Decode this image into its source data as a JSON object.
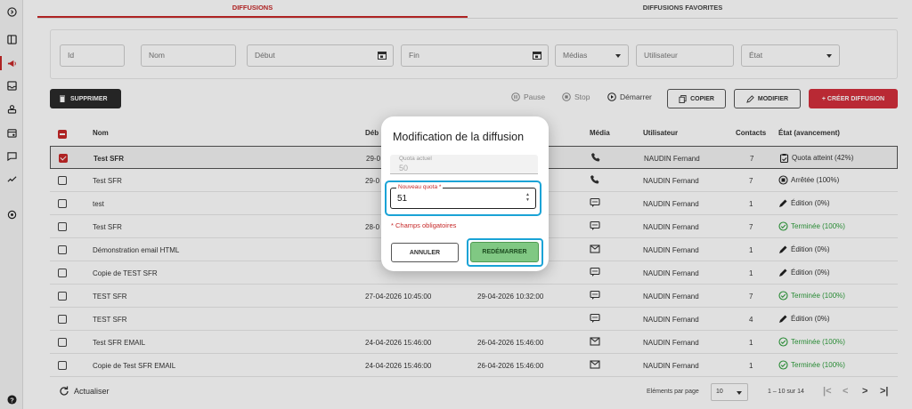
{
  "tabs": [
    {
      "label": "DIFFUSIONS",
      "active": true
    },
    {
      "label": "DIFFUSIONS FAVORITES",
      "active": false
    }
  ],
  "filters": {
    "id": "Id",
    "nom": "Nom",
    "debut": "Début",
    "fin": "Fin",
    "medias": "Médias",
    "utilisateur": "Utilisateur",
    "etat": "État"
  },
  "toolbar": {
    "delete": "SUPPRIMER",
    "pause": "Pause",
    "stop": "Stop",
    "start": "Démarrer",
    "copy": "COPIER",
    "edit": "MODIFIER",
    "create": "+ CRÉER DIFFUSION"
  },
  "table": {
    "headers": {
      "nom": "Nom",
      "debut": "Déb",
      "media": "Média",
      "utilisateur": "Utilisateur",
      "contacts": "Contacts",
      "etat": "État (avancement)"
    },
    "rows": [
      {
        "checked": true,
        "nom": "Test SFR",
        "debut": "29-0",
        "fin": "",
        "media": "phone",
        "user": "NAUDIN Fernand",
        "contacts": "7",
        "state": "Quota atteint (42%)",
        "state_kind": "quota",
        "bold": true
      },
      {
        "checked": false,
        "nom": "Test SFR",
        "debut": "29-0",
        "fin": "",
        "media": "phone",
        "user": "NAUDIN Fernand",
        "contacts": "7",
        "state": "Arrêtée (100%)",
        "state_kind": "stopped",
        "bold": false
      },
      {
        "checked": false,
        "nom": "test",
        "debut": "",
        "fin": "",
        "media": "sms",
        "user": "NAUDIN Fernand",
        "contacts": "1",
        "state": "Édition (0%)",
        "state_kind": "edit",
        "bold": false
      },
      {
        "checked": false,
        "nom": "Test SFR",
        "debut": "28-0",
        "fin": "",
        "media": "sms",
        "user": "NAUDIN Fernand",
        "contacts": "7",
        "state": "Terminée (100%)",
        "state_kind": "done",
        "bold": false
      },
      {
        "checked": false,
        "nom": "Démonstration email HTML",
        "debut": "",
        "fin": "",
        "media": "email",
        "user": "NAUDIN Fernand",
        "contacts": "1",
        "state": "Édition (0%)",
        "state_kind": "edit",
        "bold": false
      },
      {
        "checked": false,
        "nom": "Copie de TEST SFR",
        "debut": "",
        "fin": "",
        "media": "sms",
        "user": "NAUDIN Fernand",
        "contacts": "1",
        "state": "Édition (0%)",
        "state_kind": "edit",
        "bold": false
      },
      {
        "checked": false,
        "nom": "TEST SFR",
        "debut": "27-04-2026 10:45:00",
        "fin": "29-04-2026 10:32:00",
        "media": "sms",
        "user": "NAUDIN Fernand",
        "contacts": "7",
        "state": "Terminée (100%)",
        "state_kind": "done",
        "bold": false
      },
      {
        "checked": false,
        "nom": "TEST SFR",
        "debut": "",
        "fin": "",
        "media": "sms",
        "user": "NAUDIN Fernand",
        "contacts": "4",
        "state": "Édition (0%)",
        "state_kind": "edit",
        "bold": false
      },
      {
        "checked": false,
        "nom": "Test SFR EMAIL",
        "debut": "24-04-2026 15:46:00",
        "fin": "26-04-2026 15:46:00",
        "media": "email",
        "user": "NAUDIN Fernand",
        "contacts": "1",
        "state": "Terminée (100%)",
        "state_kind": "done",
        "bold": false
      },
      {
        "checked": false,
        "nom": "Copie de Test SFR EMAIL",
        "debut": "24-04-2026 15:46:00",
        "fin": "26-04-2026 15:46:00",
        "media": "email",
        "user": "NAUDIN Fernand",
        "contacts": "1",
        "state": "Terminée (100%)",
        "state_kind": "done",
        "bold": false
      }
    ]
  },
  "footer": {
    "refresh": "Actualiser",
    "per_page_label": "Eléments par page",
    "per_page_value": "10",
    "range": "1 – 10 sur 14"
  },
  "modal": {
    "title": "Modification de la diffusion",
    "current_quota_label": "Quota actuel",
    "current_quota_value": "50",
    "new_quota_label": "Nouveau quota *",
    "new_quota_value": "51",
    "required_note": "* Champs obligatoires",
    "cancel": "ANNULER",
    "restart": "REDÉMARRER"
  },
  "colors": {
    "accent": "#c62828",
    "success": "#2e9e3c",
    "focus": "#1aa3d6",
    "restart_bg": "#80c883"
  }
}
